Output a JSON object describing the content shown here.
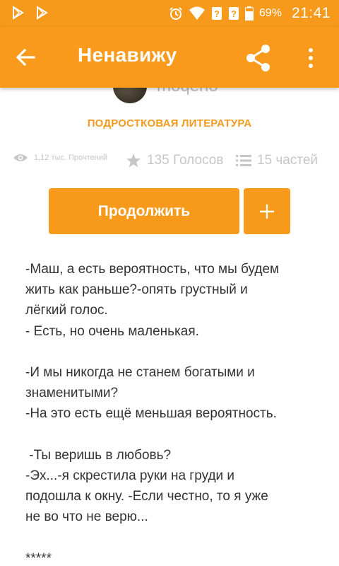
{
  "status_bar": {
    "battery": "69%",
    "time": "21:41"
  },
  "app_bar": {
    "title": "Ненавижу"
  },
  "story_header": {
    "author_name": "moqeno",
    "genre": "ПОДРОСТКОВАЯ ЛИТЕРАТУРА",
    "stats": {
      "reads": "1,12 тыс. Прочтений",
      "votes": "135 Голосов",
      "parts": "15 частей"
    }
  },
  "actions": {
    "continue_label": "Продолжить",
    "add_label": "+"
  },
  "story_text": {
    "lines": [
      "-Маш, а есть вероятность, что мы будем",
      "жить как раньше?-опять грустный и",
      "лёгкий голос.",
      "- Есть, но очень маленькая.",
      "",
      "-И мы никогда не станем богатыми и",
      "знаменитыми?",
      "-На это есть ещё меньшая вероятность.",
      "",
      " -Ты веришь в любовь?",
      "-Эх...-я скрестила руки на груди и",
      "подошла к окну. -Если честно, то я уже",
      "не во что не верю...",
      "",
      "*****"
    ]
  },
  "colors": {
    "accent": "#f79a1c",
    "genre_text": "#f39a1f",
    "muted": "#c6c6c6",
    "body_text": "#333333"
  }
}
